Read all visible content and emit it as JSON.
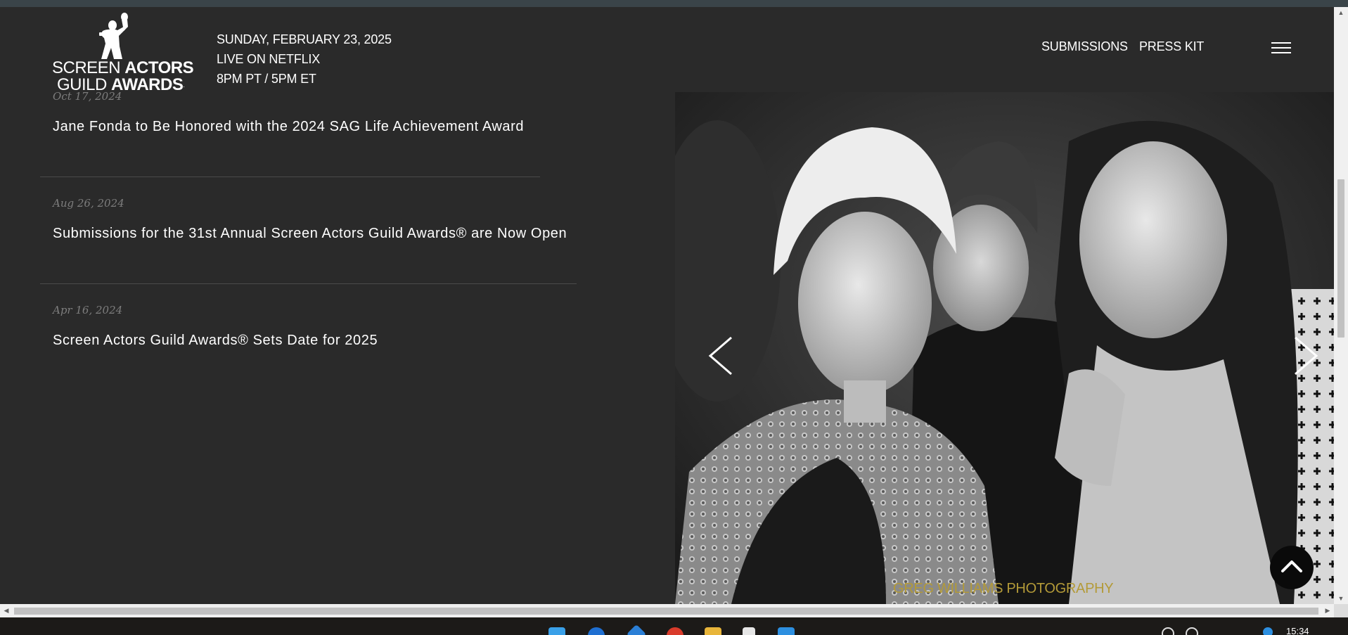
{
  "header": {
    "logo": {
      "line1_regular": "SCREEN ",
      "line1_bold": "ACTORS",
      "line2_regular": "GUILD ",
      "line2_bold": "AWARDS",
      "registered": "."
    },
    "event_date": "SUNDAY, FEBRUARY 23, 2025",
    "event_broadcast": "LIVE ON NETFLIX",
    "event_time": "8PM PT / 5PM ET",
    "nav": {
      "submissions": "SUBMISSIONS",
      "press_kit": "PRESS KIT"
    },
    "menu_icon": "hamburger-menu-icon"
  },
  "news": [
    {
      "date": "Oct 17, 2024",
      "title": "Jane Fonda to Be Honored with the 2024 SAG Life Achievement Award"
    },
    {
      "date": "Aug 26, 2024",
      "title": "Submissions for the 31st Annual Screen Actors Guild Awards® are Now Open"
    },
    {
      "date": "Apr 16, 2024",
      "title": "Screen Actors Guild Awards® Sets Date for 2025"
    }
  ],
  "carousel": {
    "photo_credit": "GREG WILLIAMS PHOTOGRAPHY",
    "prev_icon": "chevron-left-icon",
    "next_icon": "chevron-right-icon"
  },
  "back_to_top_icon": "chevron-up-icon",
  "taskbar": {
    "time": "15:34"
  },
  "colors": {
    "page_bg": "#2a2a2a",
    "credit_gold": "#b39a38",
    "date_gray": "#7d7d7d"
  }
}
